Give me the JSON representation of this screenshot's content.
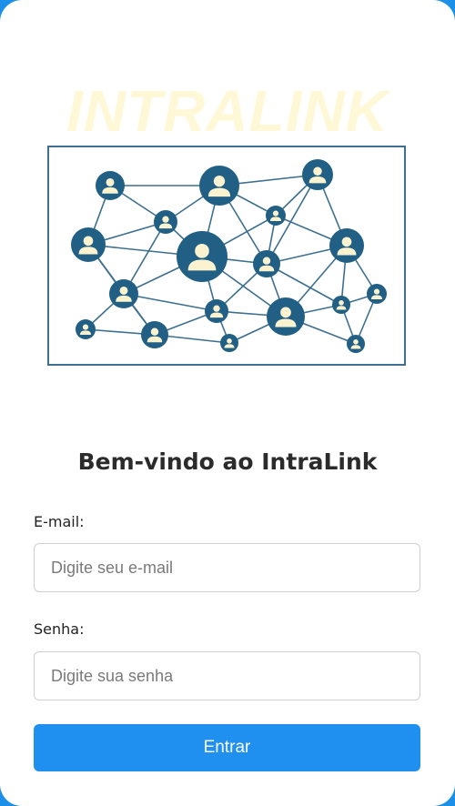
{
  "app": {
    "logo_text": "INTRALINK",
    "welcome_title": "Bem-vindo ao IntraLink"
  },
  "illustration": {
    "icon": "network-people-icon"
  },
  "form": {
    "email_label": "E-mail:",
    "email_placeholder": "Digite seu e-mail",
    "email_value": "",
    "password_label": "Senha:",
    "password_placeholder": "Digite sua senha",
    "password_value": "",
    "submit_label": "Entrar"
  },
  "colors": {
    "background": "#1c8fe8",
    "card": "#ffffff",
    "button": "#1f8ff0",
    "logo": "#fff8d6",
    "node": "#215f85"
  }
}
